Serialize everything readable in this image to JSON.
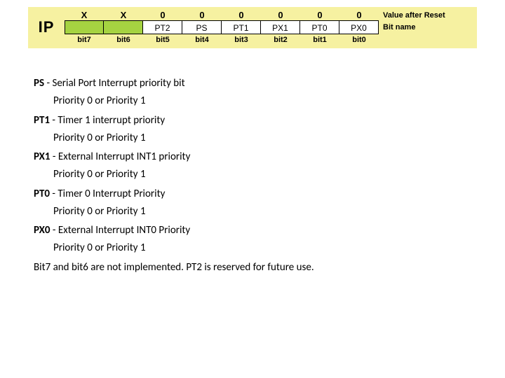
{
  "register": {
    "label": "IP",
    "right_value_label": "Value after Reset",
    "right_name_label": "Bit name",
    "values": [
      "X",
      "X",
      "0",
      "0",
      "0",
      "0",
      "0",
      "0"
    ],
    "names": [
      "",
      "",
      "PT2",
      "PS",
      "PT1",
      "PX1",
      "PT0",
      "PX0"
    ],
    "reserved": [
      true,
      true,
      false,
      false,
      false,
      false,
      false,
      false
    ],
    "bits": [
      "bit7",
      "bit6",
      "bit5",
      "bit4",
      "bit3",
      "bit2",
      "bit1",
      "bit0"
    ]
  },
  "definitions": [
    {
      "abbr": "PS",
      "desc": "Serial Port Interrupt priority bit",
      "sub": "Priority 0 or Priority 1"
    },
    {
      "abbr": "PT1",
      "desc": "Timer 1 interrupt priority",
      "sub": "Priority 0 or Priority 1"
    },
    {
      "abbr": "PX1",
      "desc": "External Interrupt INT1 priority",
      "sub": "Priority 0 or Priority 1"
    },
    {
      "abbr": "PT0",
      "desc": "Timer 0 Interrupt Priority",
      "sub": "Priority 0 or Priority 1"
    },
    {
      "abbr": "PX0",
      "desc": "External Interrupt INT0 Priority",
      "sub": "Priority 0 or Priority 1"
    }
  ],
  "footnote": "Bit7 and bit6 are not implemented. PT2 is reserved for future use.",
  "sep": " - "
}
